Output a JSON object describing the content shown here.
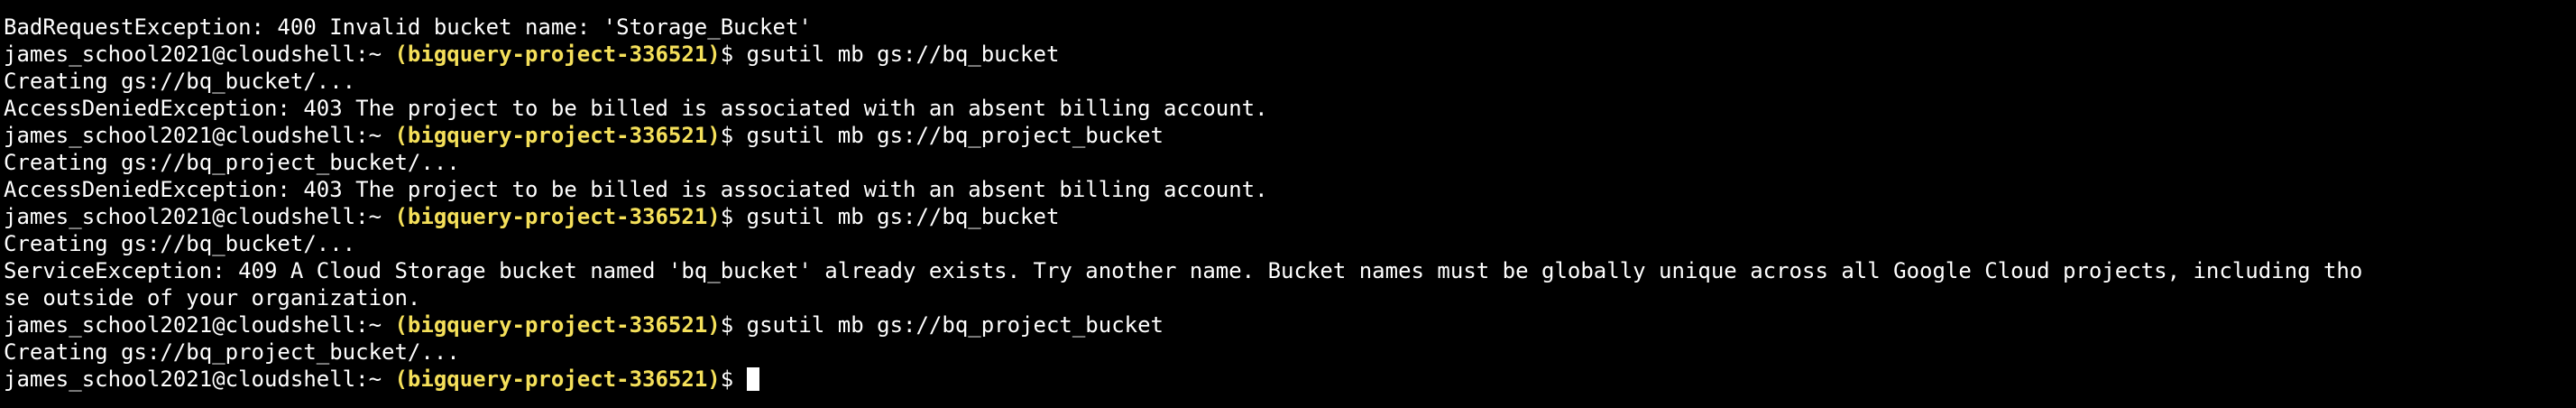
{
  "terminal": {
    "lines": [
      {
        "type": "output",
        "text": "BadRequestException: 400 Invalid bucket name: 'Storage_Bucket'"
      },
      {
        "type": "prompt",
        "user": "james_school2021@cloudshell:~",
        "project": "(bigquery-project-336521)",
        "symbol": "$",
        "command": "gsutil mb gs://bq_bucket"
      },
      {
        "type": "output",
        "text": "Creating gs://bq_bucket/..."
      },
      {
        "type": "output",
        "text": "AccessDeniedException: 403 The project to be billed is associated with an absent billing account."
      },
      {
        "type": "prompt",
        "user": "james_school2021@cloudshell:~",
        "project": "(bigquery-project-336521)",
        "symbol": "$",
        "command": "gsutil mb gs://bq_project_bucket"
      },
      {
        "type": "output",
        "text": "Creating gs://bq_project_bucket/..."
      },
      {
        "type": "output",
        "text": "AccessDeniedException: 403 The project to be billed is associated with an absent billing account."
      },
      {
        "type": "prompt",
        "user": "james_school2021@cloudshell:~",
        "project": "(bigquery-project-336521)",
        "symbol": "$",
        "command": "gsutil mb gs://bq_bucket"
      },
      {
        "type": "output",
        "text": "Creating gs://bq_bucket/..."
      },
      {
        "type": "output",
        "text": "ServiceException: 409 A Cloud Storage bucket named 'bq_bucket' already exists. Try another name. Bucket names must be globally unique across all Google Cloud projects, including tho"
      },
      {
        "type": "output",
        "text": "se outside of your organization."
      },
      {
        "type": "prompt",
        "user": "james_school2021@cloudshell:~",
        "project": "(bigquery-project-336521)",
        "symbol": "$",
        "command": "gsutil mb gs://bq_project_bucket"
      },
      {
        "type": "output",
        "text": "Creating gs://bq_project_bucket/..."
      },
      {
        "type": "prompt",
        "user": "james_school2021@cloudshell:~",
        "project": "(bigquery-project-336521)",
        "symbol": "$",
        "command": "",
        "cursor": true
      }
    ]
  }
}
